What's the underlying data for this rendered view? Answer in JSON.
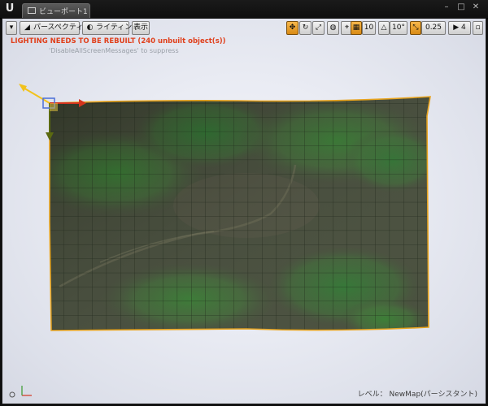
{
  "window": {
    "tab_title": "ビューポート1",
    "controls": [
      "–",
      "□",
      "✕"
    ]
  },
  "toolbar": {
    "perspective_label": "パースペクティブ",
    "lighting_label": "ライティング",
    "show_label": "表示",
    "grid_snap_value": "10",
    "rotation_snap_value": "10°",
    "scale_snap_value": "0.25",
    "camera_speed_value": "4"
  },
  "messages": {
    "lighting_warning": "LIGHTING NEEDS TO BE REBUILT (240 unbuilt object(s))",
    "suppress_hint": "'DisableAllScreenMessages' to suppress"
  },
  "status": {
    "level_label": "レベル：",
    "level_name": "NewMap(パーシスタント)"
  },
  "colors": {
    "accent": "#f0a020",
    "warning": "#e0401c",
    "terrain_dark": "#3c4a30",
    "terrain_green": "#3f7a32",
    "selection_outline": "#e8a41f"
  }
}
